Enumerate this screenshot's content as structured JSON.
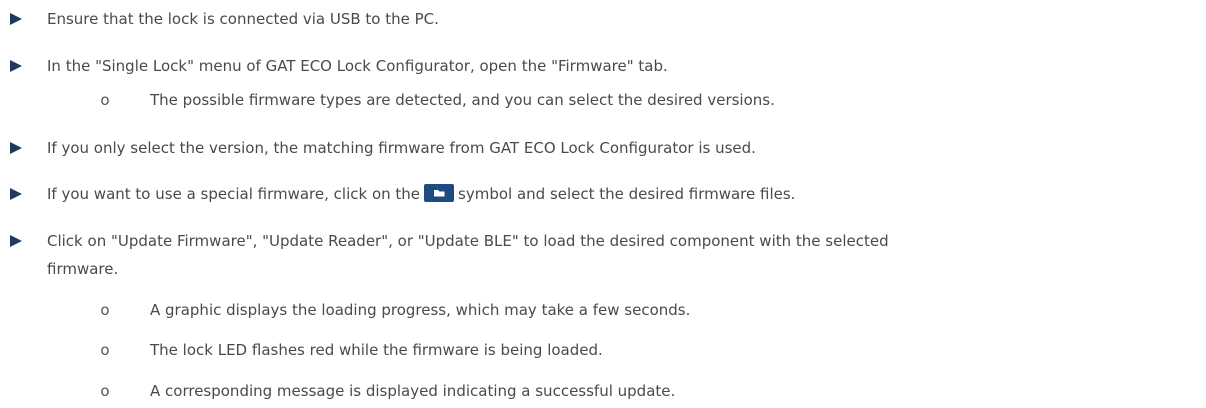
{
  "colors": {
    "text": "#4a4a4a",
    "bullet": "#1e3a5c",
    "folder_icon_bg": "#1f4b82",
    "folder_icon_fg": "#ffffff"
  },
  "icons": {
    "bullet": "right-pointing-triangle-icon",
    "symbol": "folder-icon"
  },
  "sub_marker": "o",
  "steps": [
    {
      "text": "Ensure that the lock is connected via USB to the PC."
    },
    {
      "text": "In the \"Single Lock\" menu of GAT ECO Lock Configurator, open the \"Firmware\" tab."
    },
    {
      "sub": "The possible firmware types are detected, and you can select the desired versions."
    },
    {
      "text": "If you only select the version, the matching firmware from GAT ECO Lock Configurator is used."
    },
    {
      "text_before": "If you want to use a special firmware, click on the",
      "text_after": "symbol and select the desired firmware files."
    },
    {
      "text": "Click on \"Update Firmware\", \"Update Reader\", or \"Update BLE\" to load the desired component with the selected",
      "continuation": "firmware."
    },
    {
      "sub": "A graphic displays the loading progress, which may take a few seconds."
    },
    {
      "sub": "The lock LED flashes red while the firmware is being loaded."
    },
    {
      "sub": "A corresponding message is displayed indicating a successful update."
    }
  ]
}
